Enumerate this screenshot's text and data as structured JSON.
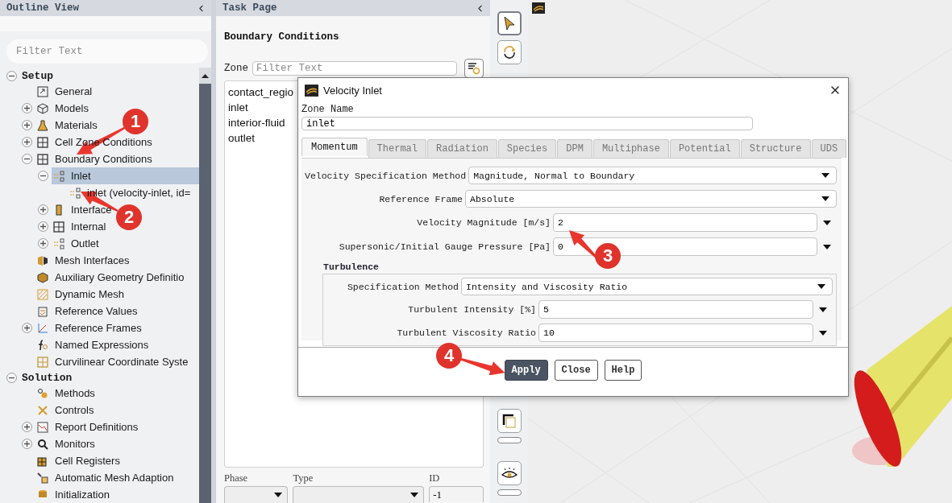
{
  "outline": {
    "title": "Outline View",
    "filter_placeholder": "Filter Text",
    "tree": [
      {
        "label": "Setup",
        "expanded": true,
        "selected": false,
        "children": [
          {
            "label": "General",
            "selected": false
          },
          {
            "label": "Models",
            "expanded": false,
            "selected": false
          },
          {
            "label": "Materials",
            "expanded": false,
            "selected": false
          },
          {
            "label": "Cell Zone Conditions",
            "expanded": false,
            "selected": false
          },
          {
            "label": "Boundary Conditions",
            "expanded": true,
            "selected": false,
            "children": [
              {
                "label": "Inlet",
                "expanded": true,
                "selected": true,
                "children": [
                  {
                    "label": "inlet (velocity-inlet, id=",
                    "selected": false
                  }
                ]
              },
              {
                "label": "Interface",
                "expanded": false,
                "selected": false
              },
              {
                "label": "Internal",
                "expanded": false,
                "selected": false
              },
              {
                "label": "Outlet",
                "expanded": false,
                "selected": false
              }
            ]
          },
          {
            "label": "Mesh Interfaces",
            "selected": false
          },
          {
            "label": "Auxiliary Geometry Definitio",
            "selected": false
          },
          {
            "label": "Dynamic Mesh",
            "selected": false
          },
          {
            "label": "Reference Values",
            "selected": false
          },
          {
            "label": "Reference Frames",
            "expanded": false,
            "selected": false
          },
          {
            "label": "Named Expressions",
            "selected": false
          },
          {
            "label": "Curvilinear Coordinate Syste",
            "selected": false
          }
        ]
      },
      {
        "label": "Solution",
        "expanded": true,
        "selected": false,
        "children": [
          {
            "label": "Methods",
            "selected": false
          },
          {
            "label": "Controls",
            "selected": false
          },
          {
            "label": "Report Definitions",
            "expanded": false,
            "selected": false
          },
          {
            "label": "Monitors",
            "expanded": false,
            "selected": false
          },
          {
            "label": "Cell Registers",
            "selected": false
          },
          {
            "label": "Automatic Mesh Adaption",
            "selected": false
          },
          {
            "label": "Initialization",
            "selected": false
          }
        ]
      }
    ]
  },
  "task_page": {
    "title": "Task Page",
    "heading": "Boundary Conditions",
    "zone_label": "Zone",
    "zone_placeholder": "Filter Text",
    "zones": [
      "contact_regio",
      "inlet",
      "interior-fluid",
      "outlet"
    ],
    "phase_label": "Phase",
    "type_label": "Type",
    "id_label": "ID",
    "id_value": "-1"
  },
  "toolbar": {
    "mode_tools": [
      {
        "selected": true
      },
      {
        "selected": false
      }
    ]
  },
  "dialog": {
    "title": "Velocity Inlet",
    "zone_name_label": "Zone Name",
    "zone_name": "inlet",
    "tabs": [
      {
        "label": "Momentum",
        "selected": true
      },
      {
        "label": "Thermal",
        "selected": false
      },
      {
        "label": "Radiation",
        "selected": false
      },
      {
        "label": "Species",
        "selected": false
      },
      {
        "label": "DPM",
        "selected": false
      },
      {
        "label": "Multiphase",
        "selected": false
      },
      {
        "label": "Potential",
        "selected": false
      },
      {
        "label": "Structure",
        "selected": false
      },
      {
        "label": "UDS",
        "selected": false
      }
    ],
    "fields": [
      {
        "kind": "dropdown",
        "label": "Velocity Specification Method",
        "value": "Magnitude, Normal to Boundary"
      },
      {
        "kind": "dropdown",
        "label": "Reference Frame",
        "value": "Absolute"
      },
      {
        "kind": "number",
        "label": "Velocity Magnitude [m/s]",
        "value": "2"
      },
      {
        "kind": "number",
        "label": "Supersonic/Initial Gauge Pressure [Pa]",
        "value": "0"
      }
    ],
    "group": {
      "title": "Turbulence",
      "fields": [
        {
          "kind": "dropdown",
          "label": "Specification Method",
          "value": "Intensity and Viscosity Ratio"
        },
        {
          "kind": "number",
          "label": "Turbulent Intensity [%]",
          "value": "5"
        },
        {
          "kind": "number",
          "label": "Turbulent Viscosity Ratio",
          "value": "10"
        }
      ]
    },
    "buttons": [
      {
        "label": "Apply",
        "primary": true
      },
      {
        "label": "Close",
        "primary": false
      },
      {
        "label": "Help",
        "primary": false
      }
    ]
  },
  "annotations": [
    {
      "number": "1"
    },
    {
      "number": "2"
    },
    {
      "number": "3"
    },
    {
      "number": "4"
    }
  ]
}
